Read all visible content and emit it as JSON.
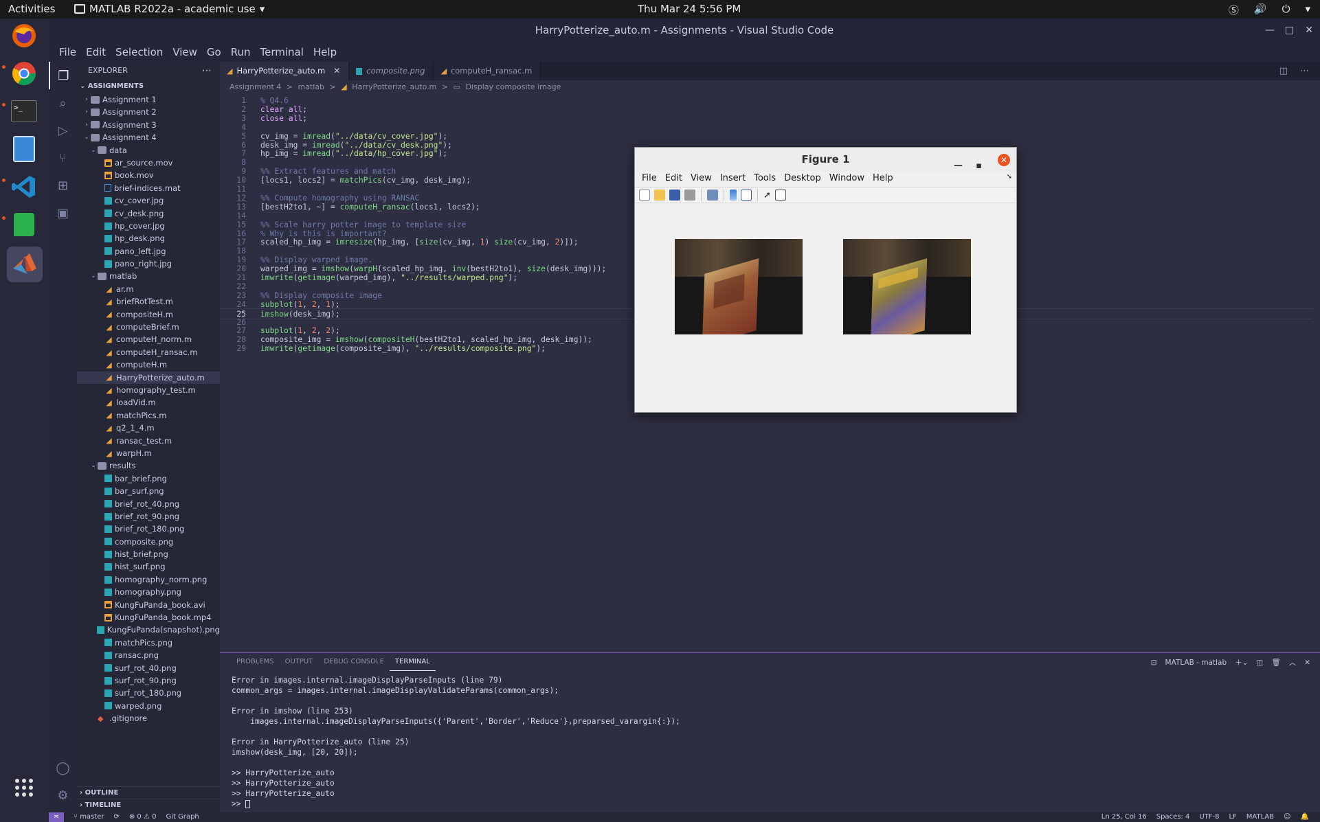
{
  "topbar": {
    "activities": "Activities",
    "app_name": "MATLAB R2022a - academic use",
    "clock": "Thu Mar 24  5:56 PM"
  },
  "window": {
    "title": "HarryPotterize_auto.m - Assignments - Visual Studio Code"
  },
  "menubar": [
    "File",
    "Edit",
    "Selection",
    "View",
    "Go",
    "Run",
    "Terminal",
    "Help"
  ],
  "sidebar": {
    "header": "EXPLORER",
    "workspace": "ASSIGNMENTS",
    "outline": "OUTLINE",
    "timeline": "TIMELINE",
    "tree": [
      {
        "depth": 0,
        "kind": "folder",
        "open": false,
        "label": "Assignment 1"
      },
      {
        "depth": 0,
        "kind": "folder",
        "open": false,
        "label": "Assignment 2"
      },
      {
        "depth": 0,
        "kind": "folder",
        "open": false,
        "label": "Assignment 3"
      },
      {
        "depth": 0,
        "kind": "folder",
        "open": true,
        "label": "Assignment 4"
      },
      {
        "depth": 1,
        "kind": "folder",
        "open": true,
        "label": "data"
      },
      {
        "depth": 2,
        "kind": "mov",
        "label": "ar_source.mov"
      },
      {
        "depth": 2,
        "kind": "mov",
        "label": "book.mov"
      },
      {
        "depth": 2,
        "kind": "mat",
        "label": "brief-indices.mat"
      },
      {
        "depth": 2,
        "kind": "png",
        "label": "cv_cover.jpg"
      },
      {
        "depth": 2,
        "kind": "png",
        "label": "cv_desk.png"
      },
      {
        "depth": 2,
        "kind": "png",
        "label": "hp_cover.jpg"
      },
      {
        "depth": 2,
        "kind": "png",
        "label": "hp_desk.png"
      },
      {
        "depth": 2,
        "kind": "png",
        "label": "pano_left.jpg"
      },
      {
        "depth": 2,
        "kind": "png",
        "label": "pano_right.jpg"
      },
      {
        "depth": 1,
        "kind": "folder",
        "open": true,
        "label": "matlab"
      },
      {
        "depth": 2,
        "kind": "m",
        "label": "ar.m"
      },
      {
        "depth": 2,
        "kind": "m",
        "label": "briefRotTest.m"
      },
      {
        "depth": 2,
        "kind": "m",
        "label": "compositeH.m"
      },
      {
        "depth": 2,
        "kind": "m",
        "label": "computeBrief.m"
      },
      {
        "depth": 2,
        "kind": "m",
        "label": "computeH_norm.m"
      },
      {
        "depth": 2,
        "kind": "m",
        "label": "computeH_ransac.m"
      },
      {
        "depth": 2,
        "kind": "m",
        "label": "computeH.m"
      },
      {
        "depth": 2,
        "kind": "m",
        "label": "HarryPotterize_auto.m",
        "selected": true
      },
      {
        "depth": 2,
        "kind": "m",
        "label": "homography_test.m"
      },
      {
        "depth": 2,
        "kind": "m",
        "label": "loadVid.m"
      },
      {
        "depth": 2,
        "kind": "m",
        "label": "matchPics.m"
      },
      {
        "depth": 2,
        "kind": "m",
        "label": "q2_1_4.m"
      },
      {
        "depth": 2,
        "kind": "m",
        "label": "ransac_test.m"
      },
      {
        "depth": 2,
        "kind": "m",
        "label": "warpH.m"
      },
      {
        "depth": 1,
        "kind": "folder",
        "open": true,
        "label": "results"
      },
      {
        "depth": 2,
        "kind": "png",
        "label": "bar_brief.png"
      },
      {
        "depth": 2,
        "kind": "png",
        "label": "bar_surf.png"
      },
      {
        "depth": 2,
        "kind": "png",
        "label": "brief_rot_40.png"
      },
      {
        "depth": 2,
        "kind": "png",
        "label": "brief_rot_90.png"
      },
      {
        "depth": 2,
        "kind": "png",
        "label": "brief_rot_180.png"
      },
      {
        "depth": 2,
        "kind": "png",
        "label": "composite.png"
      },
      {
        "depth": 2,
        "kind": "png",
        "label": "hist_brief.png"
      },
      {
        "depth": 2,
        "kind": "png",
        "label": "hist_surf.png"
      },
      {
        "depth": 2,
        "kind": "png",
        "label": "homography_norm.png"
      },
      {
        "depth": 2,
        "kind": "png",
        "label": "homography.png"
      },
      {
        "depth": 2,
        "kind": "mov",
        "label": "KungFuPanda_book.avi"
      },
      {
        "depth": 2,
        "kind": "mov",
        "label": "KungFuPanda_book.mp4"
      },
      {
        "depth": 2,
        "kind": "png",
        "label": "KungFuPanda(snapshot).png"
      },
      {
        "depth": 2,
        "kind": "png",
        "label": "matchPics.png"
      },
      {
        "depth": 2,
        "kind": "png",
        "label": "ransac.png"
      },
      {
        "depth": 2,
        "kind": "png",
        "label": "surf_rot_40.png"
      },
      {
        "depth": 2,
        "kind": "png",
        "label": "surf_rot_90.png"
      },
      {
        "depth": 2,
        "kind": "png",
        "label": "surf_rot_180.png"
      },
      {
        "depth": 2,
        "kind": "png",
        "label": "warped.png"
      },
      {
        "depth": 1,
        "kind": "git",
        "label": ".gitignore"
      }
    ]
  },
  "tabs": [
    {
      "label": "HarryPotterize_auto.m",
      "kind": "m",
      "active": true
    },
    {
      "label": "composite.png",
      "kind": "png",
      "italic": true
    },
    {
      "label": "computeH_ransac.m",
      "kind": "m"
    }
  ],
  "breadcrumb": [
    "Assignment 4",
    ">",
    "matlab",
    ">",
    "HarryPotterize_auto.m",
    ">",
    "Display composite image"
  ],
  "editor": {
    "current_line": 25,
    "lines": [
      [
        [
          "com",
          "% Q4.6"
        ]
      ],
      [
        [
          "kw",
          "clear"
        ],
        [
          "var",
          " "
        ],
        [
          "kw",
          "all"
        ],
        [
          "var",
          ";"
        ]
      ],
      [
        [
          "kw",
          "close"
        ],
        [
          "var",
          " "
        ],
        [
          "kw",
          "all"
        ],
        [
          "var",
          ";"
        ]
      ],
      [],
      [
        [
          "var",
          "cv_img = "
        ],
        [
          "fn",
          "imread"
        ],
        [
          "var",
          "("
        ],
        [
          "str",
          "\"../data/cv_cover.jpg\""
        ],
        [
          "var",
          ");"
        ]
      ],
      [
        [
          "var",
          "desk_img = "
        ],
        [
          "fn",
          "imread"
        ],
        [
          "var",
          "("
        ],
        [
          "str",
          "\"../data/cv_desk.png\""
        ],
        [
          "var",
          ");"
        ]
      ],
      [
        [
          "var",
          "hp_img = "
        ],
        [
          "fn",
          "imread"
        ],
        [
          "var",
          "("
        ],
        [
          "str",
          "\"../data/hp_cover.jpg\""
        ],
        [
          "var",
          ");"
        ]
      ],
      [],
      [
        [
          "com",
          "%% Extract features and match"
        ]
      ],
      [
        [
          "var",
          "[locs1, locs2] = "
        ],
        [
          "fn",
          "matchPics"
        ],
        [
          "var",
          "(cv_img, desk_img);"
        ]
      ],
      [],
      [
        [
          "com",
          "%% Compute homography using RANSAC"
        ]
      ],
      [
        [
          "var",
          "[bestH2to1, ~] = "
        ],
        [
          "fn",
          "computeH_ransac"
        ],
        [
          "var",
          "(locs1, locs2);"
        ]
      ],
      [],
      [
        [
          "com",
          "%% Scale harry potter image to template size"
        ]
      ],
      [
        [
          "com",
          "% Why is this is important?"
        ]
      ],
      [
        [
          "var",
          "scaled_hp_img = "
        ],
        [
          "fn",
          "imresize"
        ],
        [
          "var",
          "(hp_img, ["
        ],
        [
          "fn",
          "size"
        ],
        [
          "var",
          "(cv_img, "
        ],
        [
          "num",
          "1"
        ],
        [
          "var",
          ") "
        ],
        [
          "fn",
          "size"
        ],
        [
          "var",
          "(cv_img, "
        ],
        [
          "num",
          "2"
        ],
        [
          "var",
          ")]);"
        ]
      ],
      [],
      [
        [
          "com",
          "%% Display warped image."
        ]
      ],
      [
        [
          "var",
          "warped_img = "
        ],
        [
          "fn",
          "imshow"
        ],
        [
          "var",
          "("
        ],
        [
          "fn",
          "warpH"
        ],
        [
          "var",
          "(scaled_hp_img, "
        ],
        [
          "fn",
          "inv"
        ],
        [
          "var",
          "(bestH2to1), "
        ],
        [
          "fn",
          "size"
        ],
        [
          "var",
          "(desk_img)));"
        ]
      ],
      [
        [
          "fn",
          "imwrite"
        ],
        [
          "var",
          "("
        ],
        [
          "fn",
          "getimage"
        ],
        [
          "var",
          "(warped_img), "
        ],
        [
          "str",
          "\"../results/warped.png\""
        ],
        [
          "var",
          ");"
        ]
      ],
      [],
      [
        [
          "com",
          "%% Display composite image"
        ]
      ],
      [
        [
          "fn",
          "subplot"
        ],
        [
          "var",
          "("
        ],
        [
          "num",
          "1"
        ],
        [
          "var",
          ", "
        ],
        [
          "num",
          "2"
        ],
        [
          "var",
          ", "
        ],
        [
          "num",
          "1"
        ],
        [
          "var",
          ");"
        ]
      ],
      [
        [
          "fn",
          "imshow"
        ],
        [
          "var",
          "(desk_img);"
        ]
      ],
      [],
      [
        [
          "fn",
          "subplot"
        ],
        [
          "var",
          "("
        ],
        [
          "num",
          "1"
        ],
        [
          "var",
          ", "
        ],
        [
          "num",
          "2"
        ],
        [
          "var",
          ", "
        ],
        [
          "num",
          "2"
        ],
        [
          "var",
          ");"
        ]
      ],
      [
        [
          "var",
          "composite_img = "
        ],
        [
          "fn",
          "imshow"
        ],
        [
          "var",
          "("
        ],
        [
          "fn",
          "compositeH"
        ],
        [
          "var",
          "(bestH2to1, scaled_hp_img, desk_img));"
        ]
      ],
      [
        [
          "fn",
          "imwrite"
        ],
        [
          "var",
          "("
        ],
        [
          "fn",
          "getimage"
        ],
        [
          "var",
          "(composite_img), "
        ],
        [
          "str",
          "\"../results/composite.png\""
        ],
        [
          "var",
          ");"
        ]
      ]
    ]
  },
  "panel": {
    "tabs": [
      "PROBLEMS",
      "OUTPUT",
      "DEBUG CONSOLE",
      "TERMINAL"
    ],
    "active_tab": "TERMINAL",
    "terminal_name": "MATLAB - matlab",
    "terminal_text": "Error in images.internal.imageDisplayParseInputs (line 79)\ncommon_args = images.internal.imageDisplayValidateParams(common_args);\n\nError in imshow (line 253)\n    images.internal.imageDisplayParseInputs({'Parent','Border','Reduce'},preparsed_varargin{:});\n\nError in HarryPotterize_auto (line 25)\nimshow(desk_img, [20, 20]);\n\n>> HarryPotterize_auto\n>> HarryPotterize_auto\n>> HarryPotterize_auto\n>> "
  },
  "statusbar": {
    "branch": "master",
    "problems": "⊗ 0 ⚠ 0",
    "git_graph": "Git Graph",
    "position": "Ln 25, Col 16",
    "spaces": "Spaces: 4",
    "encoding": "UTF-8",
    "eol": "LF",
    "language": "MATLAB"
  },
  "figure": {
    "title": "Figure 1",
    "menu": [
      "File",
      "Edit",
      "View",
      "Insert",
      "Tools",
      "Desktop",
      "Window",
      "Help"
    ]
  },
  "colors": {
    "accent": "#7a5fbf",
    "ubuntu_orange": "#e95420",
    "editor_bg": "#2d2e41"
  }
}
